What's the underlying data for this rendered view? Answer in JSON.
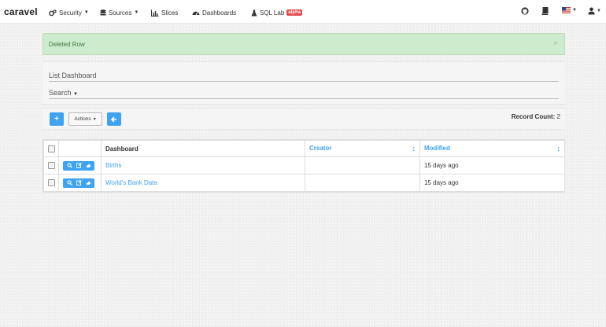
{
  "navbar": {
    "brand": "caravel",
    "items": [
      {
        "label": "Security",
        "icon": "gears-icon"
      },
      {
        "label": "Sources",
        "icon": "database-icon"
      },
      {
        "label": "Slices",
        "icon": "bar-chart-icon"
      },
      {
        "label": "Dashboards",
        "icon": "dashboard-icon"
      },
      {
        "label": "SQL Lab",
        "icon": "flask-icon",
        "badge": "alpha"
      }
    ],
    "right_icons": [
      "github-icon",
      "book-icon",
      "us-flag-icon",
      "user-icon"
    ]
  },
  "alert": {
    "message": "Deleted Row",
    "close": "×",
    "color": "#cdeccd"
  },
  "list": {
    "title": "List Dashboard",
    "search_label": "Search"
  },
  "toolbar": {
    "add_label": "+",
    "actions_label": "Actions",
    "record_count_label": "Record Count:",
    "record_count_value": "2"
  },
  "table": {
    "columns": [
      "Dashboard",
      "Creator",
      "Modified"
    ],
    "rows": [
      {
        "dashboard": "Births",
        "creator": "",
        "modified": "15 days ago"
      },
      {
        "dashboard": "World's Bank Data",
        "creator": "",
        "modified": "15 days ago"
      }
    ]
  },
  "colors": {
    "accent": "#3ea3f2",
    "badge": "#e04b4b"
  }
}
